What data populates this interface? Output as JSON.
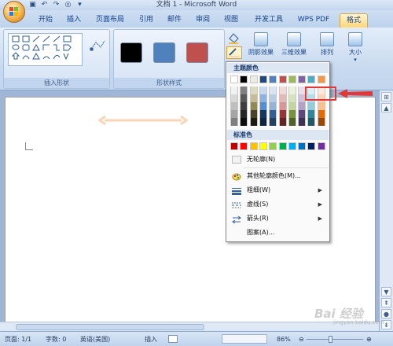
{
  "window": {
    "title": "文档 1 - Microsoft Word"
  },
  "quick_access": [
    "save-icon",
    "undo-icon",
    "redo-icon",
    "print-preview-icon",
    "customize-icon"
  ],
  "tabs": [
    {
      "label": "开始",
      "active": false
    },
    {
      "label": "插入",
      "active": false
    },
    {
      "label": "页面布局",
      "active": false
    },
    {
      "label": "引用",
      "active": false
    },
    {
      "label": "邮件",
      "active": false
    },
    {
      "label": "审阅",
      "active": false
    },
    {
      "label": "视图",
      "active": false
    },
    {
      "label": "开发工具",
      "active": false
    },
    {
      "label": "WPS PDF",
      "active": false
    },
    {
      "label": "格式",
      "active": true
    }
  ],
  "ribbon": {
    "insert_shapes_label": "插入形状",
    "shape_styles_label": "形状样式",
    "shape_style_colors": [
      "#000000",
      "#4f81bd",
      "#c0504d"
    ],
    "shadow_effect_label": "阴影效果",
    "threed_effect_label": "三维效果",
    "arrange_label": "排列",
    "size_label": "大小"
  },
  "outline_menu": {
    "theme_colors_header": "主题颜色",
    "theme_top_row": [
      "#ffffff",
      "#000000",
      "#eeece1",
      "#1f497d",
      "#4f81bd",
      "#c0504d",
      "#9bbb59",
      "#8064a2",
      "#4bacc6",
      "#f79646"
    ],
    "theme_shades": [
      [
        "#f2f2f2",
        "#7f7f7f",
        "#ddd9c3",
        "#c6d9f0",
        "#dbe5f1",
        "#f2dcdb",
        "#ebf1dd",
        "#e5e0ec",
        "#dbeef3",
        "#fdeada"
      ],
      [
        "#d8d8d8",
        "#595959",
        "#c4bd97",
        "#8db3e2",
        "#b8cce4",
        "#e5b9b7",
        "#d7e3bc",
        "#ccc1d9",
        "#b7dde8",
        "#fbd5b5"
      ],
      [
        "#bfbfbf",
        "#3f3f3f",
        "#938953",
        "#548dd4",
        "#95b3d7",
        "#d99694",
        "#c3d69b",
        "#b2a2c7",
        "#92cddc",
        "#fac08f"
      ],
      [
        "#a5a5a5",
        "#262626",
        "#494429",
        "#17365d",
        "#366092",
        "#953734",
        "#76923c",
        "#5f497a",
        "#31859b",
        "#e36c09"
      ],
      [
        "#7f7f7f",
        "#0c0c0c",
        "#1d1b10",
        "#0f243e",
        "#244061",
        "#632423",
        "#4f6128",
        "#3f3151",
        "#205867",
        "#974806"
      ]
    ],
    "standard_colors_header": "标准色",
    "standard_colors": [
      "#c00000",
      "#ff0000",
      "#ffc000",
      "#ffff00",
      "#92d050",
      "#00b050",
      "#00b0f0",
      "#0070c0",
      "#002060",
      "#7030a0"
    ],
    "no_outline_label": "无轮廓(N)",
    "more_colors_label": "其他轮廓颜色(M)...",
    "weight_label": "粗细(W)",
    "dashes_label": "虚线(S)",
    "arrows_label": "箭头(R)",
    "pattern_label": "图案(A)..."
  },
  "status": {
    "page": "页面: 1/1",
    "words": "字数: 0",
    "language": "英语(美国)",
    "insert_mode": "插入",
    "zoom": "86%",
    "zoom_level": 0.86
  },
  "document": {
    "arrow_color": "#fbd5b5"
  },
  "highlight_color": "#e23838",
  "watermark": {
    "text": "Bai 经验",
    "sub": "jingyan.baidu.com"
  }
}
